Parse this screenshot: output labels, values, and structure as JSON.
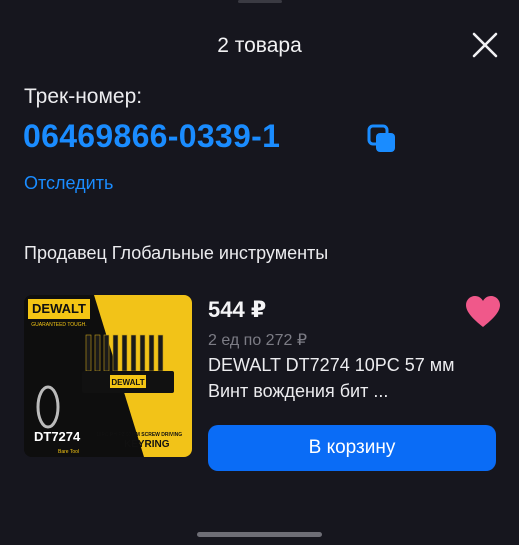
{
  "header": {
    "title": "2 товара"
  },
  "tracking": {
    "label": "Трек-номер:",
    "number": "06469866-0339-1",
    "track_link": "Отследить"
  },
  "seller": {
    "text": "Продавец Глобальные инструменты"
  },
  "product": {
    "price": "544 ₽",
    "unit_price": "2 ед по 272 ₽",
    "name": "DEWALT DT7274 10PC 57 мм Винт вождения бит ...",
    "image_text": {
      "brand": "DEWALT",
      "tagline": "GUARANTEED TOUGH.",
      "model": "DT7274",
      "caption": "10PC PH PZ 57MM SCREW DRIVING",
      "keyring": "KEYRING",
      "tag": "Bare Tool"
    }
  },
  "actions": {
    "add_to_cart": "В корзину"
  },
  "colors": {
    "accent": "#1a8cff",
    "button": "#0a6cf6",
    "heart": "#f0588a",
    "background": "#16161e"
  }
}
